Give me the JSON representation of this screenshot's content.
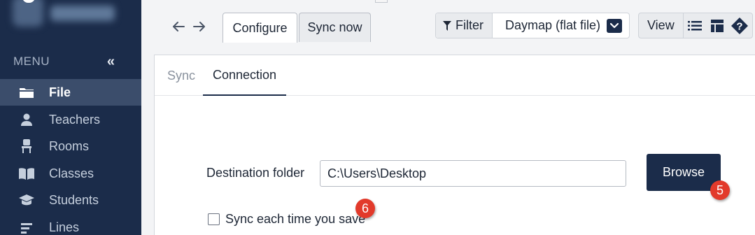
{
  "sidebar": {
    "menu_label": "MENU",
    "collapse_glyph": "«",
    "items": [
      {
        "label": "File",
        "icon": "folder-icon",
        "active": true
      },
      {
        "label": "Teachers",
        "icon": "person-icon",
        "active": false
      },
      {
        "label": "Rooms",
        "icon": "chair-icon",
        "active": false
      },
      {
        "label": "Classes",
        "icon": "book-icon",
        "active": false
      },
      {
        "label": "Students",
        "icon": "graduation-cap-icon",
        "active": false
      },
      {
        "label": "Lines",
        "icon": "lines-icon",
        "active": false
      }
    ]
  },
  "toolbar": {
    "back_icon": "arrow-left-icon",
    "forward_icon": "arrow-right-icon",
    "tabs": [
      {
        "label": "Configure",
        "active": true
      },
      {
        "label": "Sync now",
        "active": false
      }
    ],
    "filter_label": "Filter",
    "filter_icon": "funnel-icon",
    "selected_source": "Daymap (flat file)",
    "view_label": "View",
    "view_icons": [
      "list-icon",
      "layout-icon",
      "help-icon"
    ]
  },
  "panel": {
    "tabs": [
      {
        "label": "Sync",
        "active": false
      },
      {
        "label": "Connection",
        "active": true
      }
    ],
    "destination_label": "Destination folder",
    "destination_value": "C:\\Users\\Desktop",
    "browse_label": "Browse",
    "checkbox_label": "Sync each time you save",
    "checkbox_checked": false
  },
  "annotations": [
    {
      "number": "5"
    },
    {
      "number": "6"
    }
  ],
  "colors": {
    "sidebar_bg": "#1b2c4a",
    "sidebar_active": "#3b4d6b",
    "accent_dark": "#1b2c4a",
    "badge_red": "#e23a2b"
  }
}
